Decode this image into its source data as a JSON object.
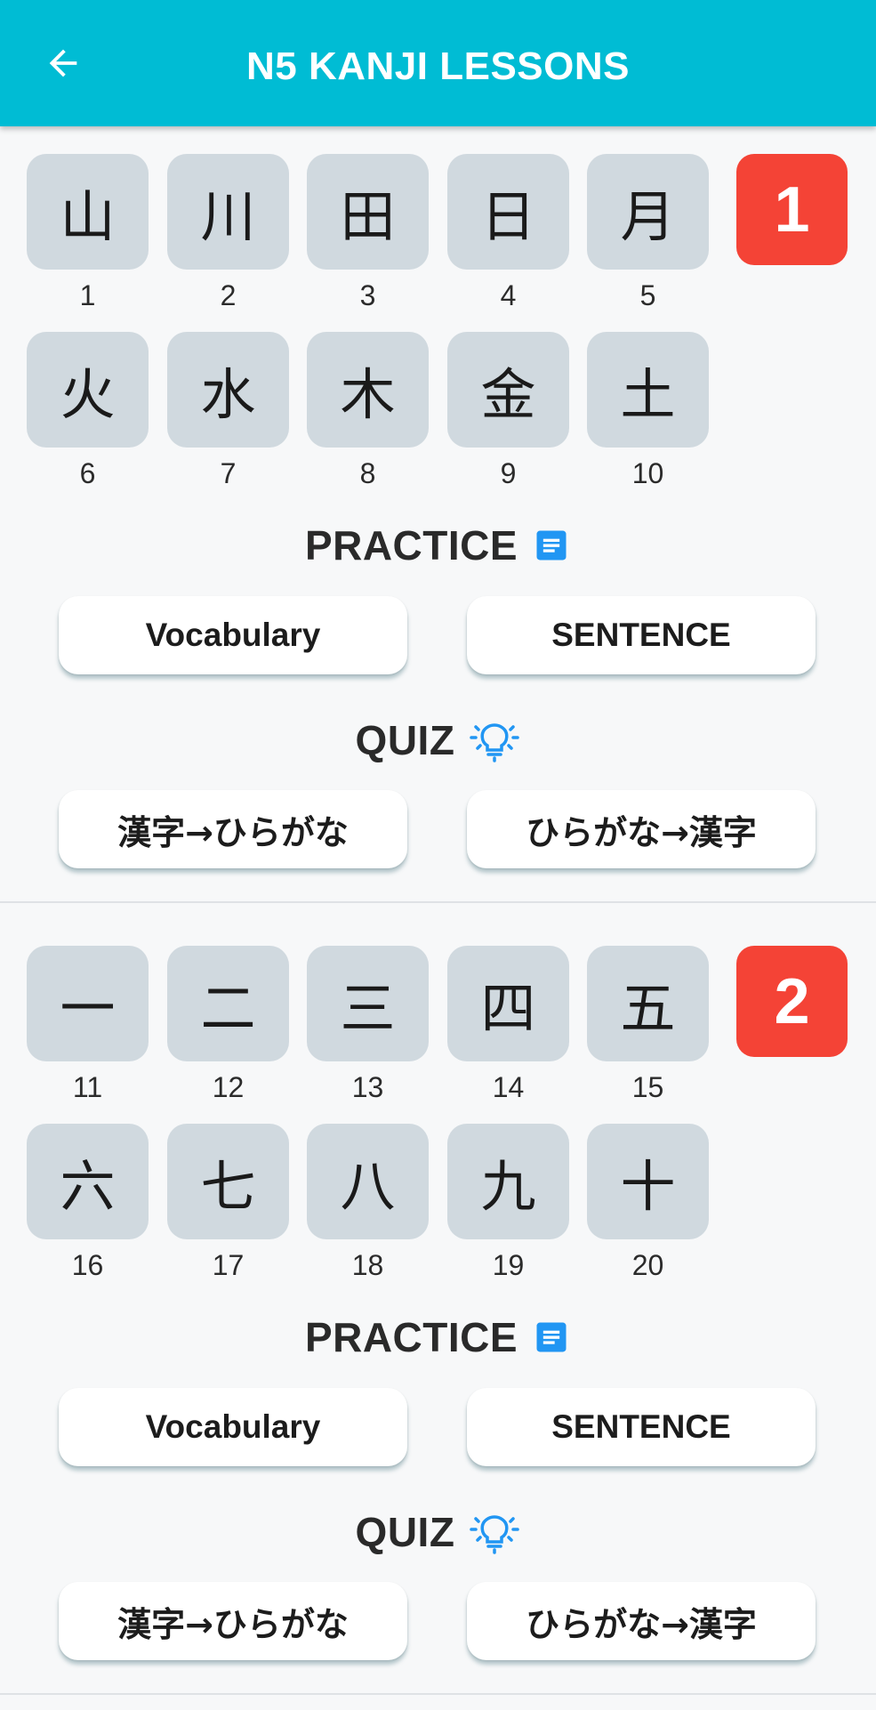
{
  "appbar": {
    "title": "N5 KANJI LESSONS",
    "back_icon": "arrow-left-icon",
    "color": "#00bcd4"
  },
  "lessons": [
    {
      "badge": "1",
      "kanji": [
        {
          "char": "山",
          "num": "1"
        },
        {
          "char": "川",
          "num": "2"
        },
        {
          "char": "田",
          "num": "3"
        },
        {
          "char": "日",
          "num": "4"
        },
        {
          "char": "月",
          "num": "5"
        },
        {
          "char": "火",
          "num": "6"
        },
        {
          "char": "水",
          "num": "7"
        },
        {
          "char": "木",
          "num": "8"
        },
        {
          "char": "金",
          "num": "9"
        },
        {
          "char": "土",
          "num": "10"
        }
      ],
      "practice": {
        "title": "PRACTICE",
        "icon": "document-icon",
        "vocab_label": "Vocabulary",
        "sentence_label": "SENTENCE"
      },
      "quiz": {
        "title": "QUIZ",
        "icon": "lightbulb-icon",
        "kanji_to_hira_label": "漢字→ひらがな",
        "hira_to_kanji_label": "ひらがな→漢字"
      }
    },
    {
      "badge": "2",
      "kanji": [
        {
          "char": "一",
          "num": "11"
        },
        {
          "char": "二",
          "num": "12"
        },
        {
          "char": "三",
          "num": "13"
        },
        {
          "char": "四",
          "num": "14"
        },
        {
          "char": "五",
          "num": "15"
        },
        {
          "char": "六",
          "num": "16"
        },
        {
          "char": "七",
          "num": "17"
        },
        {
          "char": "八",
          "num": "18"
        },
        {
          "char": "九",
          "num": "19"
        },
        {
          "char": "十",
          "num": "20"
        }
      ],
      "practice": {
        "title": "PRACTICE",
        "icon": "document-icon",
        "vocab_label": "Vocabulary",
        "sentence_label": "SENTENCE"
      },
      "quiz": {
        "title": "QUIZ",
        "icon": "lightbulb-icon",
        "kanji_to_hira_label": "漢字→ひらがな",
        "hira_to_kanji_label": "ひらがな→漢字"
      }
    }
  ],
  "colors": {
    "tile": "#d0d9df",
    "badge": "#f44336",
    "icon_blue": "#2196f3"
  }
}
